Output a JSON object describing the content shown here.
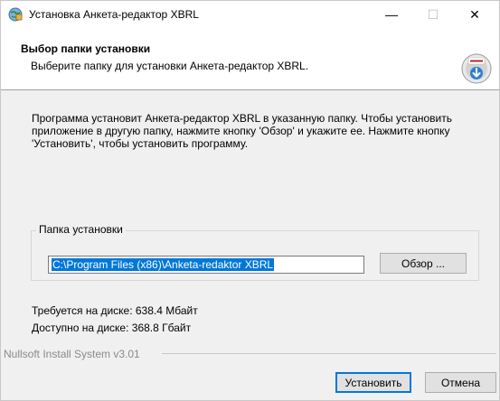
{
  "window": {
    "title": "Установка Анкета-редактор XBRL",
    "app_icon": "installer-globe-icon",
    "controls": {
      "minimize": "—",
      "maximize": "☐",
      "close": "✕"
    }
  },
  "header": {
    "title": "Выбор папки установки",
    "subtitle": "Выберите папку для установки Анкета-редактор XBRL.",
    "icon": "install-disc-icon"
  },
  "body": {
    "intro": "Программа установит Анкета-редактор XBRL в указанную папку. Чтобы установить приложение в другую папку, нажмите кнопку 'Обзор' и укажите ее. Нажмите кнопку 'Установить', чтобы установить программу.",
    "group_label": "Папка установки",
    "path_value": "C:\\Program Files (x86)\\Anketa-redaktor XBRL",
    "browse_label": "Обзор ...",
    "space_required": "Требуется на диске: 638.4 Мбайт",
    "space_available": "Доступно на диске: 368.8 Гбайт"
  },
  "footer": {
    "brand": "Nullsoft Install System v3.01",
    "install_label": "Установить",
    "cancel_label": "Отмена"
  },
  "colors": {
    "accent": "#0078d7",
    "panel": "#f0f0f0",
    "header_bg": "#ffffff"
  }
}
